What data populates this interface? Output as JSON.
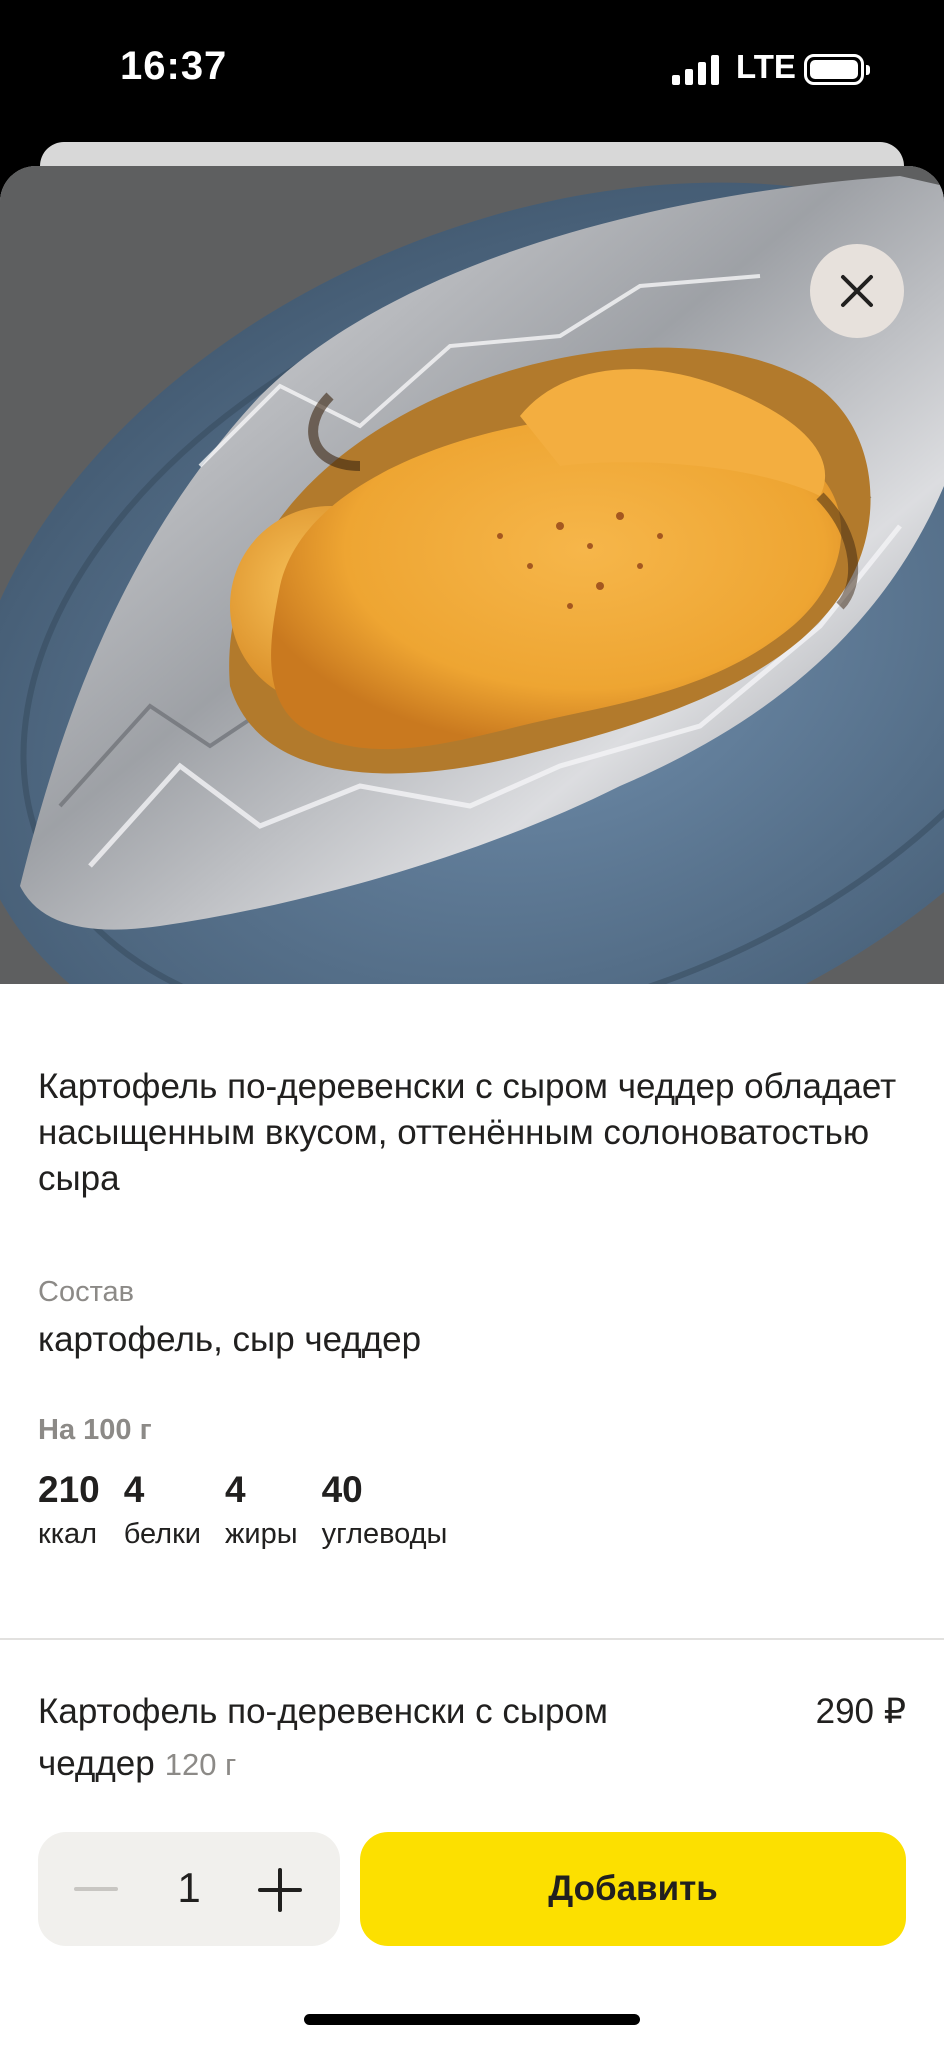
{
  "status_bar": {
    "time": "16:37",
    "network": "LTE",
    "icons": [
      "signal-icon",
      "battery-icon"
    ]
  },
  "photo": {
    "icon": "close-icon"
  },
  "product": {
    "description": "Картофель по-деревенски с сыром чеддер обладает насыщенным вкусом, оттенённым солоноватостью сыра",
    "composition_label": "Состав",
    "composition": "картофель, сыр чеддер",
    "per100_label": "На 100 г",
    "nutrients": [
      {
        "value": "210",
        "unit": "ккал"
      },
      {
        "value": "4",
        "unit": "белки"
      },
      {
        "value": "4",
        "unit": "жиры"
      },
      {
        "value": "40",
        "unit": "углеводы"
      }
    ],
    "title": "Картофель по-деревенски с сыром чеддер",
    "weight": "120 г",
    "price": "290 ₽"
  },
  "cart": {
    "quantity": "1",
    "add_label": "Добавить",
    "minus_icon": "minus-icon",
    "plus_icon": "plus-icon"
  },
  "colors": {
    "accent": "#fce000",
    "text": "#21201f",
    "secondary": "#8c8a87"
  }
}
